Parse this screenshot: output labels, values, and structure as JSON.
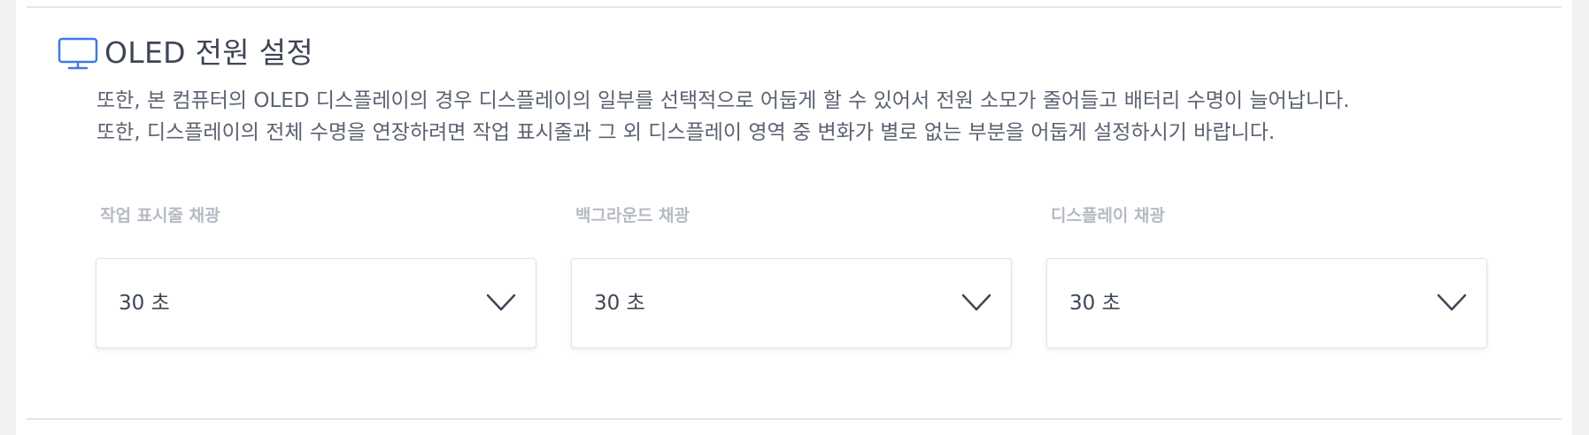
{
  "section": {
    "icon": "monitor-icon",
    "title": "OLED 전원 설정",
    "description": [
      "또한, 본 컴퓨터의 OLED 디스플레이의 경우 디스플레이의 일부를 선택적으로 어둡게 할 수 있어서 전원 소모가 줄어들고 배터리 수명이 늘어납니다.",
      "또한, 디스플레이의 전체 수명을 연장하려면 작업 표시줄과 그 외 디스플레이 영역 중 변화가 별로 없는 부분을 어둡게 설정하시기 바랍니다."
    ]
  },
  "fields": [
    {
      "label": "작업 표시줄 채광",
      "value": "30 초"
    },
    {
      "label": "백그라운드 채광",
      "value": "30 초"
    },
    {
      "label": "디스플레이 채광",
      "value": "30 초"
    }
  ],
  "colors": {
    "accent": "#3f7be0",
    "text_primary": "#3e4655",
    "text_secondary": "#5b6271",
    "label": "#b6bac3",
    "divider": "#e3e5e8"
  }
}
